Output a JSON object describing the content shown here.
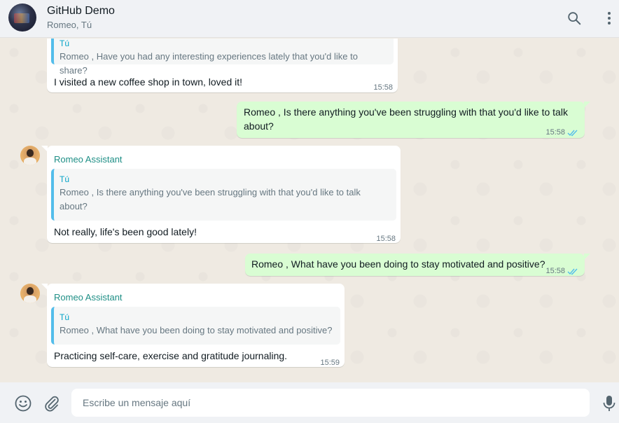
{
  "header": {
    "title": "GitHub Demo",
    "subtitle": "Romeo, Tú",
    "search_icon": "search-icon",
    "menu_icon": "kebab-menu-icon"
  },
  "messages": [
    {
      "direction": "in",
      "quote_name": "Tú",
      "quote_text": "Romeo , Have you had any interesting experiences lately that you'd like to share?",
      "text": "I visited a new coffee shop in town, loved it!",
      "time": "15:58"
    },
    {
      "direction": "out",
      "text": "Romeo , Is there anything you've been struggling with that you'd like to talk about?",
      "time": "15:58",
      "status": "read"
    },
    {
      "direction": "in",
      "sender": "Romeo Assistant",
      "quote_name": "Tú",
      "quote_text": "Romeo , Is there anything you've been struggling with that you'd like to talk about?",
      "text": "Not really, life's been good lately!",
      "time": "15:58"
    },
    {
      "direction": "out",
      "text": "Romeo , What have you been doing to stay motivated and positive?",
      "time": "15:58",
      "status": "read"
    },
    {
      "direction": "in",
      "sender": "Romeo Assistant",
      "quote_name": "Tú",
      "quote_text": "Romeo , What have you been doing to stay motivated and positive?",
      "text": "Practicing self-care, exercise and gratitude journaling.",
      "time": "15:59"
    }
  ],
  "composer": {
    "placeholder": "Escribe un mensaje aquí",
    "emoji_icon": "emoji-icon",
    "attach_icon": "paperclip-icon",
    "mic_icon": "microphone-icon"
  },
  "colors": {
    "header_bg": "#f0f2f5",
    "chat_bg": "#efeae2",
    "outgoing_bubble": "#d9fdd3",
    "incoming_bubble": "#ffffff",
    "sender_name": "#1f8f86",
    "quote_bar": "#53bdeb",
    "read_ticks": "#53bdeb"
  }
}
